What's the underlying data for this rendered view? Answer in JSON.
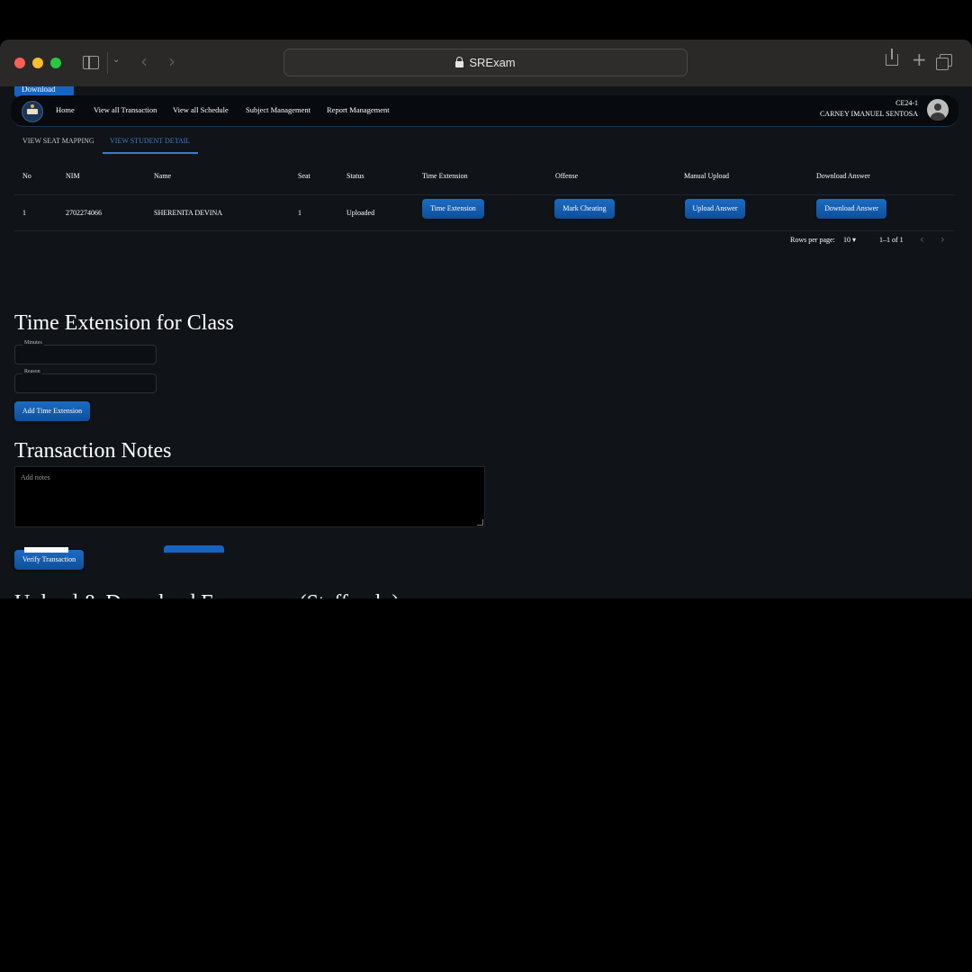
{
  "browser": {
    "url": "SRExam"
  },
  "appbar": {
    "peek_button": "Download",
    "nav": [
      "Home",
      "View all Transaction",
      "View all Schedule",
      "Subject Management",
      "Report Management"
    ],
    "class_code": "CE24-1",
    "user_name": "CARNEY IMANUEL SENTOSA"
  },
  "subtabs": [
    "VIEW SEAT MAPPING",
    "VIEW STUDENT DETAIL"
  ],
  "table": {
    "headers": [
      "No",
      "NIM",
      "Name",
      "Seat",
      "Status",
      "Time Extension",
      "Offense",
      "Manual Upload",
      "Download Answer"
    ],
    "rows": [
      {
        "no": "1",
        "nim": "2702274066",
        "name": "SHERENITA DEVINA",
        "seat": "1",
        "status": "Uploaded",
        "time_extension_btn": "Time Extension",
        "offense_btn": "Mark Cheating",
        "upload_btn": "Upload Answer",
        "download_btn": "Download Answer"
      }
    ],
    "rows_per_page_label": "Rows per page:",
    "rows_per_page": "10",
    "range": "1–1 of 1"
  },
  "time_extension": {
    "title": "Time Extension for Class",
    "minutes_label": "Minutes",
    "reason_label": "Reason",
    "button": "Add Time Extension"
  },
  "notes": {
    "title": "Transaction Notes",
    "placeholder": "Add notes",
    "button": "Verify Transaction"
  },
  "upload_section": {
    "title": "Upload & Download Exam case (Staff only)"
  }
}
